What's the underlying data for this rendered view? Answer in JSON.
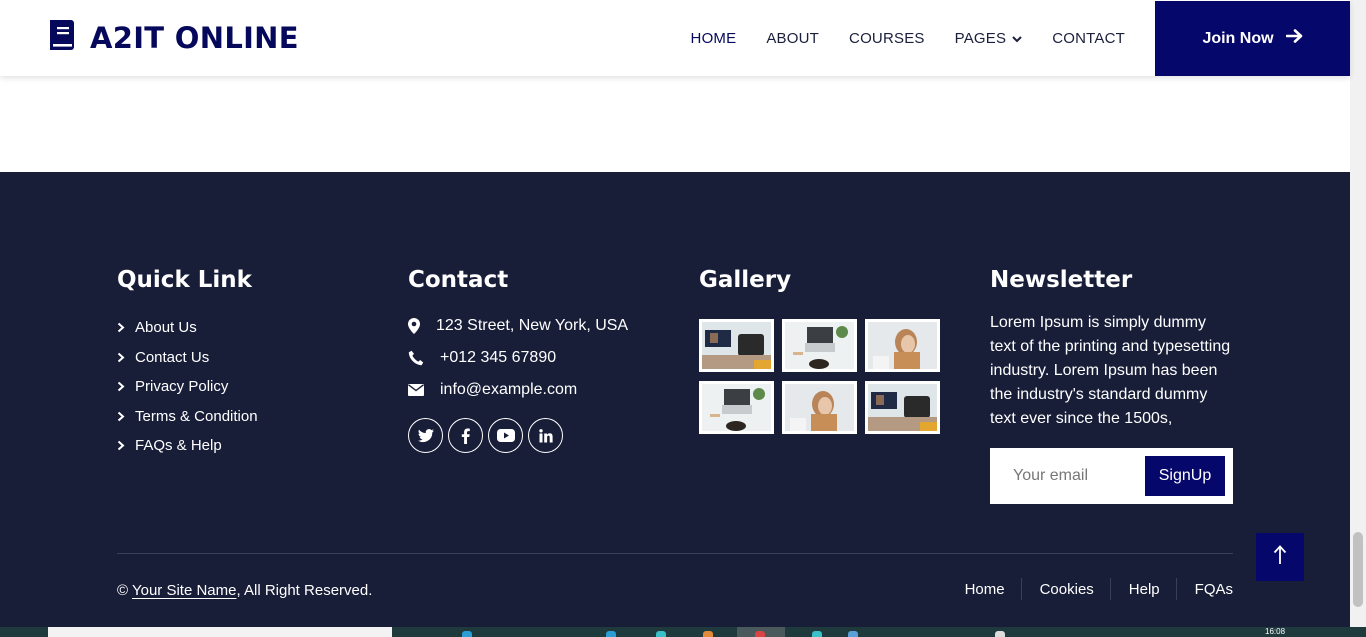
{
  "brand": {
    "name": "A2IT ONLINE",
    "icon": "book-icon"
  },
  "nav": {
    "items": [
      {
        "label": "HOME",
        "active": true
      },
      {
        "label": "ABOUT"
      },
      {
        "label": "COURSES"
      },
      {
        "label": "PAGES",
        "dropdown": true
      },
      {
        "label": "CONTACT"
      }
    ],
    "join_label": "Join Now"
  },
  "footer": {
    "quick_link": {
      "title": "Quick Link",
      "items": [
        "About Us",
        "Contact Us",
        "Privacy Policy",
        "Terms & Condition",
        "FAQs & Help"
      ]
    },
    "contact": {
      "title": "Contact",
      "address": "123 Street, New York, USA",
      "phone": "+012 345 67890",
      "email": "info@example.com",
      "socials": [
        "twitter-icon",
        "facebook-icon",
        "youtube-icon",
        "linkedin-icon"
      ]
    },
    "gallery": {
      "title": "Gallery",
      "images": [
        "course-image-1",
        "course-image-2",
        "course-image-3",
        "course-image-2",
        "course-image-3",
        "course-image-1"
      ]
    },
    "newsletter": {
      "title": "Newsletter",
      "text": "Lorem Ipsum is simply dummy text of the printing and typesetting industry. Lorem Ipsum has been the industry's standard dummy text ever since the 1500s,",
      "placeholder": "Your email",
      "button": "SignUp"
    },
    "copyright": {
      "symbol": "©",
      "site": "Your Site Name",
      "rest": ", All Right Reserved."
    },
    "menu": [
      "Home",
      "Cookies",
      "Help",
      "FQAs"
    ]
  },
  "taskbar": {
    "clock": "16:08"
  },
  "colors": {
    "navy": "#06076b",
    "footer_bg": "#181d38",
    "brand_text": "#06095b"
  }
}
